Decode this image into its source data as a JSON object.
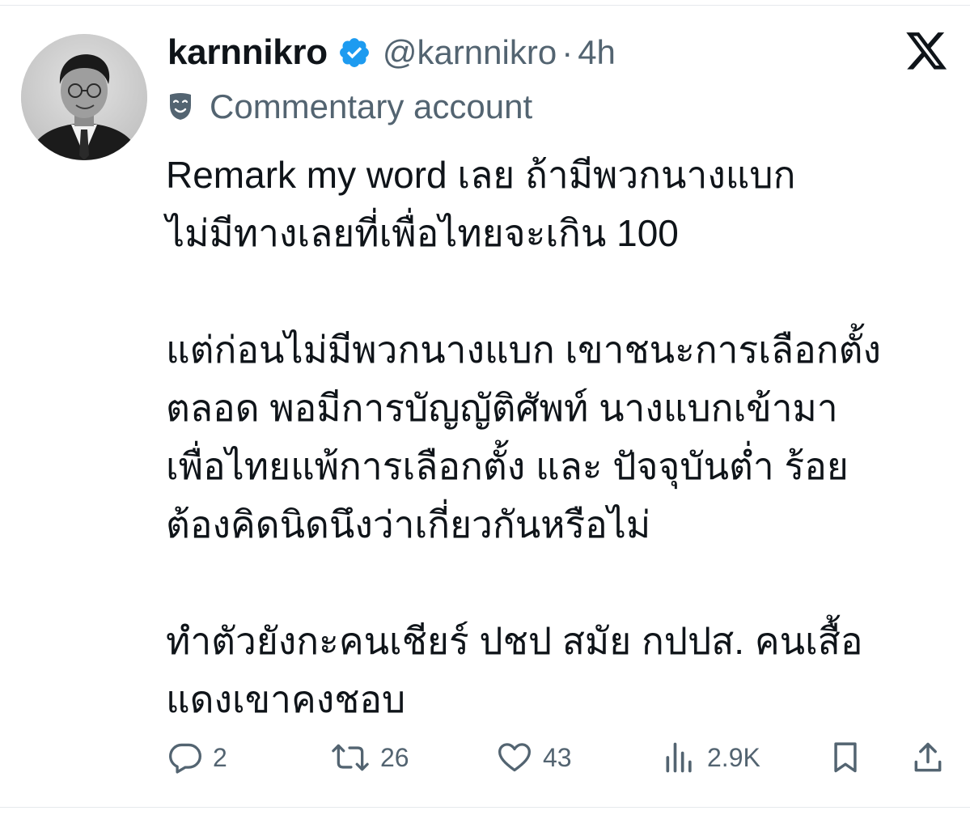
{
  "tweet": {
    "author": {
      "display_name": "karnnikro",
      "handle": "@karnnikro",
      "separator": "·",
      "time_ago": "4h",
      "label": "Commentary account"
    },
    "paragraphs": [
      "Remark my word เลย ถ้ามีพวกนางแบก\nไม่มีทางเลยที่เพื่อไทยจะเกิน 100",
      "แต่ก่อนไม่มีพวกนางแบก เขาชนะการเลือกตั้ง\nตลอด พอมีการบัญญัติศัพท์ นางแบกเข้ามา\nเพื่อไทยแพ้การเลือกตั้ง และ ปัจจุบันต่ำ ร้อย\nต้องคิดนิดนึงว่าเกี่ยวกันหรือไม่",
      "ทำตัวยังกะคนเชียร์ ปชป สมัย กปปส. คนเสื้อ\nแดงเขาคงชอบ"
    ],
    "metrics": {
      "replies": "2",
      "reposts": "26",
      "likes": "43",
      "views": "2.9K"
    }
  },
  "icons": {
    "verified": "verified-badge-icon",
    "platform": "x-logo-icon",
    "label": "theater-mask-icon",
    "reply": "reply-icon",
    "repost": "repost-icon",
    "like": "heart-icon",
    "views": "views-icon",
    "bookmark": "bookmark-icon",
    "share": "share-icon"
  },
  "colors": {
    "text_primary": "#0f1419",
    "text_secondary": "#536471",
    "verified_blue": "#1d9bf0",
    "background": "#ffffff"
  }
}
